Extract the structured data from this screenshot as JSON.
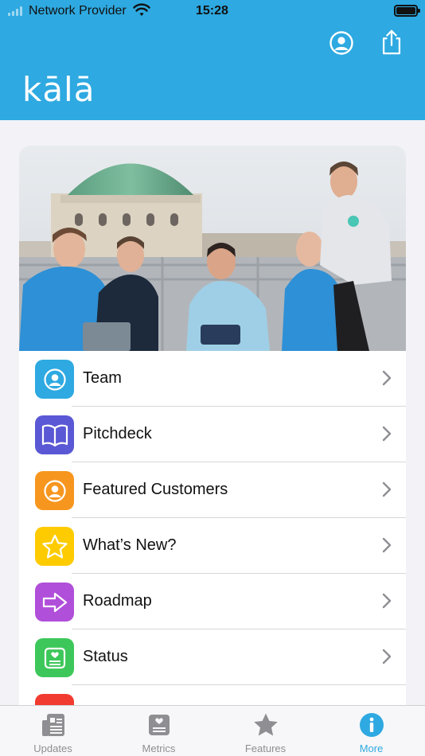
{
  "status_bar": {
    "carrier": "Network Provider",
    "time": "15:28"
  },
  "header": {
    "logo_text": "kālā",
    "profile_icon": "person-circle-icon",
    "share_icon": "share-icon"
  },
  "colors": {
    "brand": "#2ea9e1",
    "team": "#2ea9e1",
    "pitchdeck": "#5a58d4",
    "featured": "#f7961e",
    "whatsnew": "#fecb00",
    "roadmap": "#b04fd9",
    "status": "#3dc75a",
    "next": "#f23b30"
  },
  "menu": [
    {
      "label": "Team",
      "icon": "person-circle-icon"
    },
    {
      "label": "Pitchdeck",
      "icon": "book-icon"
    },
    {
      "label": "Featured Customers",
      "icon": "person-circle-icon"
    },
    {
      "label": "What’s New?",
      "icon": "star-icon"
    },
    {
      "label": "Roadmap",
      "icon": "arrow-right-icon"
    },
    {
      "label": "Status",
      "icon": "status-board-icon"
    }
  ],
  "tabs": [
    {
      "label": "Updates",
      "icon": "newspaper-icon"
    },
    {
      "label": "Metrics",
      "icon": "metrics-board-icon"
    },
    {
      "label": "Features",
      "icon": "star-fill-icon"
    },
    {
      "label": "More",
      "icon": "info-circle-icon"
    }
  ]
}
